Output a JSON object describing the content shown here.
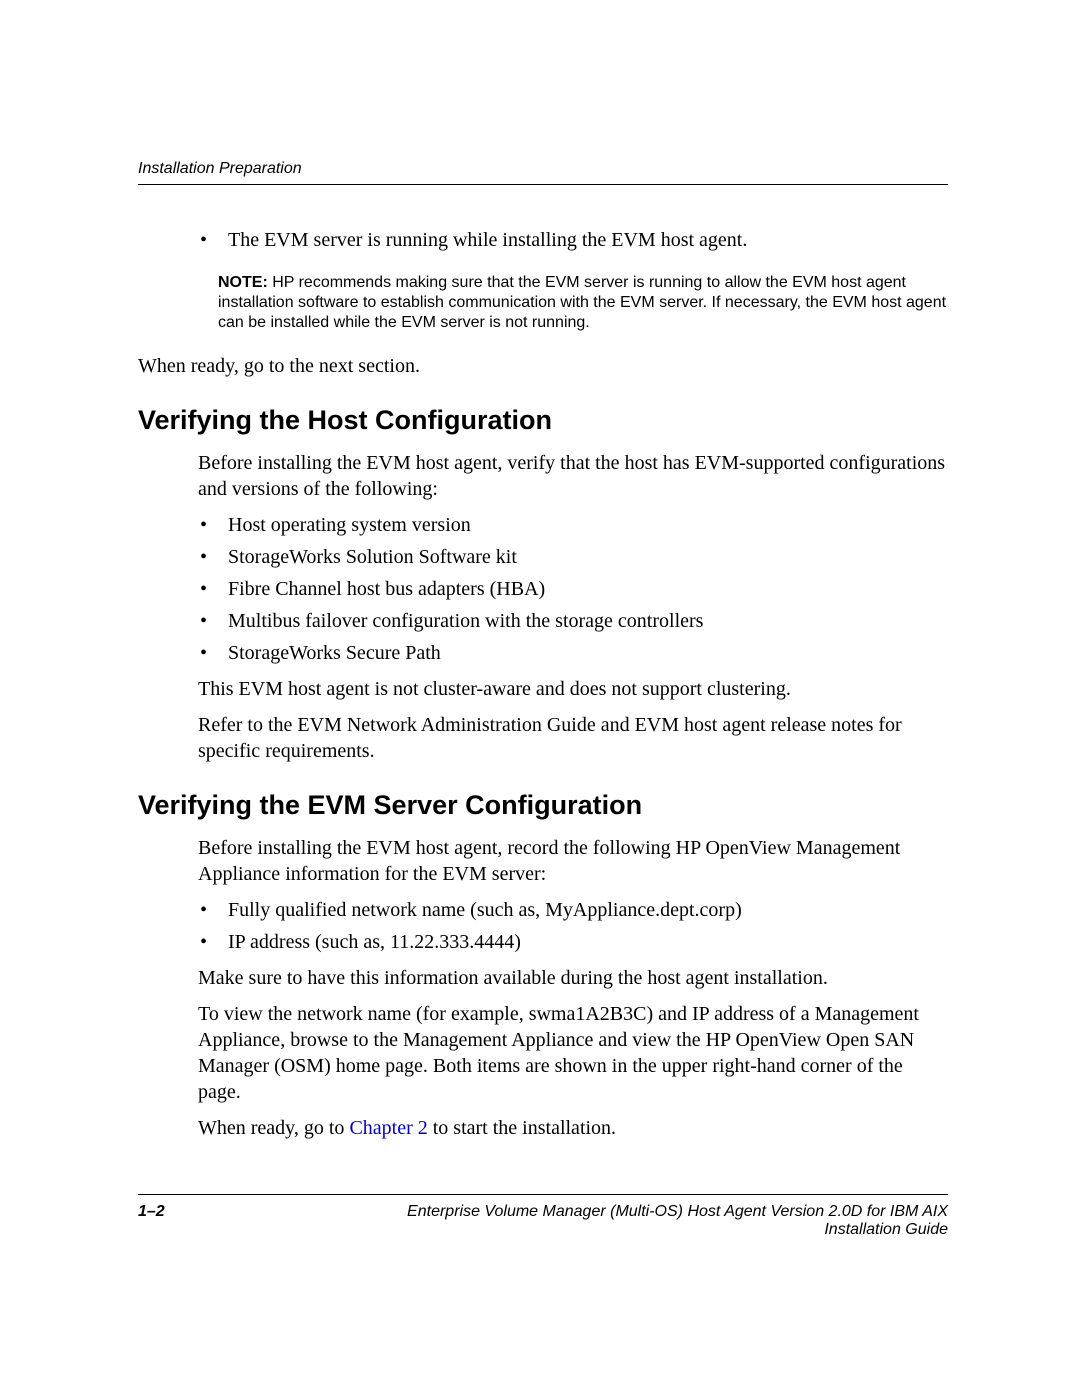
{
  "header": {
    "running": "Installation Preparation"
  },
  "intro": {
    "bullet1": "The EVM server is running while installing the EVM host agent.",
    "note_label": "NOTE:  ",
    "note_body": "HP recommends making sure that the EVM server is running to allow the EVM host agent installation software to establish communication with the EVM server. If necessary, the EVM host agent can be installed while the EVM server is not running.",
    "after": "When ready, go to the next section."
  },
  "sec1": {
    "title": "Verifying the Host Configuration",
    "p1": "Before installing the EVM host agent, verify that the host has EVM-supported configurations and versions of the following:",
    "items": [
      "Host operating system version",
      "StorageWorks Solution Software kit",
      "Fibre Channel host bus adapters (HBA)",
      "Multibus failover configuration with the storage controllers",
      "StorageWorks Secure Path"
    ],
    "p2": "This EVM host agent is not cluster-aware and does not support clustering.",
    "p3": "Refer to the EVM Network Administration Guide and EVM host agent release notes for specific requirements."
  },
  "sec2": {
    "title": "Verifying the EVM Server Configuration",
    "p1": "Before installing the EVM host agent, record the following HP OpenView Management Appliance information for the EVM server:",
    "items": [
      "Fully qualified network name (such as, MyAppliance.dept.corp)",
      "IP address (such as, 11.22.333.4444)"
    ],
    "p2": "Make sure to have this information available during the host agent installation.",
    "p3": "To view the network name (for example, swma1A2B3C) and IP address of a Management Appliance, browse to the Management Appliance and view the HP OpenView Open SAN Manager (OSM) home page. Both items are shown in the upper right-hand corner of the page.",
    "p4_pre": "When ready, go to ",
    "p4_link": "Chapter 2",
    "p4_post": " to start the installation."
  },
  "footer": {
    "page": "1–2",
    "title_line1": "Enterprise Volume Manager (Multi-OS) Host Agent Version 2.0D for IBM AIX",
    "title_line2": "Installation Guide"
  }
}
